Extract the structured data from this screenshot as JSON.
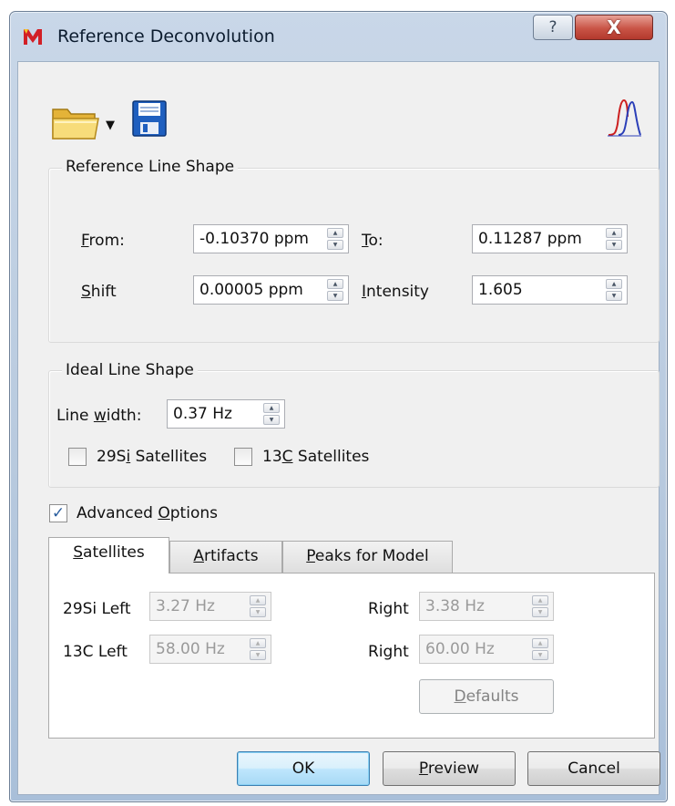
{
  "window": {
    "title": "Reference Deconvolution",
    "help_glyph": "?",
    "close_glyph": "X",
    "icons": [
      "app-icon",
      "help-icon",
      "close-icon"
    ]
  },
  "toolbar": {
    "icons": [
      "folder-open-icon",
      "dropdown-arrow-icon",
      "save-icon",
      "spectrum-peak-icon"
    ]
  },
  "reference_line_shape": {
    "title": "Reference Line Shape",
    "from_label": "From:",
    "from_mnemonic": "F",
    "from_value": "-0.10370 ppm",
    "to_label": "To:",
    "to_value": "0.11287 ppm",
    "shift_label": "Shift",
    "shift_value": "0.00005 ppm",
    "intensity_label": "Intensity",
    "intensity_value": "1.605"
  },
  "ideal_line_shape": {
    "title": "Ideal Line Shape",
    "line_width_label": "Line width:",
    "line_width_value": "0.37 Hz",
    "si_satellites_label": "29Si Satellites",
    "si_satellites_checked": false,
    "c_satellites_label": "13C Satellites",
    "c_satellites_checked": false
  },
  "advanced_options": {
    "label": "Advanced Options",
    "checked": true
  },
  "tabs": [
    {
      "label": "Satellites",
      "active": true
    },
    {
      "label": "Artifacts",
      "active": false
    },
    {
      "label": "Peaks for Model",
      "active": false
    }
  ],
  "satellites_panel": {
    "si_left_label": "29Si Left",
    "si_left_value": "3.27 Hz",
    "si_right_label": "Right",
    "si_right_value": "3.38 Hz",
    "c_left_label": "13C Left",
    "c_left_value": "58.00 Hz",
    "c_right_label": "Right",
    "c_right_value": "60.00 Hz",
    "defaults_label": "Defaults"
  },
  "buttons": {
    "ok": "OK",
    "preview": "Preview",
    "cancel": "Cancel"
  },
  "colors": {
    "titlebar": "#b7c9de",
    "close_button": "#c95446",
    "dialog_background": "#f0f0f0",
    "checkmark": "#2a5d9e",
    "spectrum_red": "#cc2020",
    "spectrum_blue": "#2b3fb8"
  }
}
